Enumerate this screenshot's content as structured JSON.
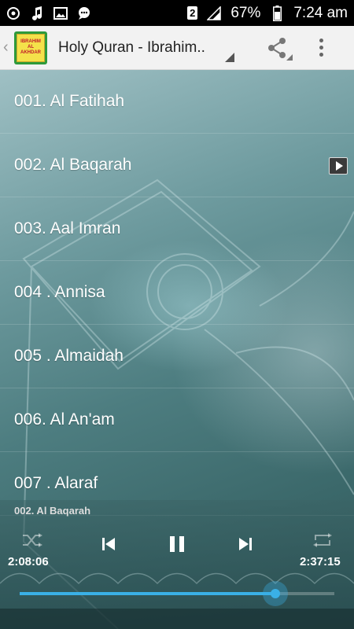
{
  "status_bar": {
    "sim": "2",
    "battery": "67%",
    "time": "7:24 am"
  },
  "action_bar": {
    "title": "Holy Quran - Ibrahim..",
    "logo_text": "IBRAHIM AL AKHDAR"
  },
  "surahs": [
    {
      "label": "001. Al Fatihah"
    },
    {
      "label": "002. Al Baqarah",
      "playing": true
    },
    {
      "label": "003. Aal Imran"
    },
    {
      "label": "004 . Annisa"
    },
    {
      "label": "005 . Almaidah"
    },
    {
      "label": "006. Al An'am"
    },
    {
      "label": "007 . Alaraf"
    }
  ],
  "player": {
    "now_playing": "002. Al Baqarah",
    "elapsed": "2:08:06",
    "total": "2:37:15",
    "progress": 0.812
  },
  "colors": {
    "accent": "#3ab0e6",
    "action_bar_bg": "#f2f2f2",
    "status_bar_bg": "#000000"
  },
  "icons": [
    "sync-icon",
    "music-note-icon",
    "image-icon",
    "chat-icon",
    "sim-icon",
    "signal-icon",
    "battery-icon",
    "share-icon",
    "overflow-menu-icon",
    "play-badge-icon",
    "shuffle-icon",
    "previous-icon",
    "pause-icon",
    "next-icon",
    "repeat-icon"
  ]
}
